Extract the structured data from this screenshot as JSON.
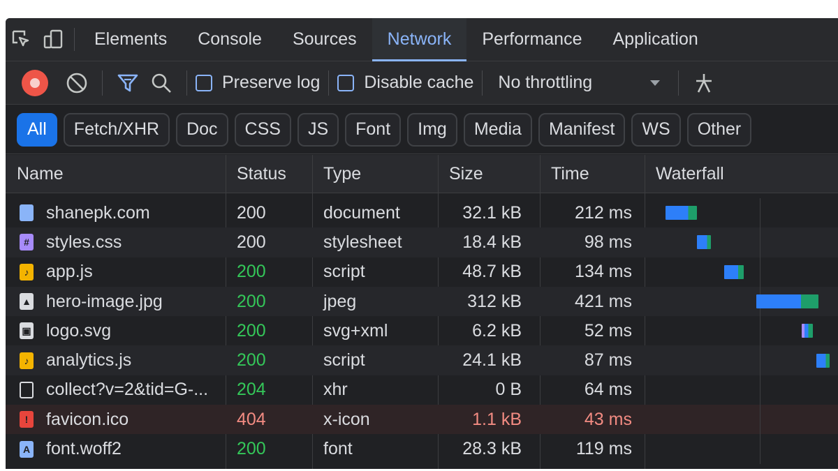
{
  "tabs": [
    {
      "label": "Elements",
      "active": false
    },
    {
      "label": "Console",
      "active": false
    },
    {
      "label": "Sources",
      "active": false
    },
    {
      "label": "Network",
      "active": true
    },
    {
      "label": "Performance",
      "active": false
    },
    {
      "label": "Application",
      "active": false
    }
  ],
  "toolbar": {
    "preserve_log": "Preserve log",
    "disable_cache": "Disable cache",
    "throttling": "No throttling"
  },
  "filters": [
    "All",
    "Fetch/XHR",
    "Doc",
    "CSS",
    "JS",
    "Font",
    "Img",
    "Media",
    "Manifest",
    "WS",
    "Other"
  ],
  "active_filter": "All",
  "columns": {
    "name": "Name",
    "status": "Status",
    "type": "Type",
    "size": "Size",
    "time": "Time",
    "waterfall": "Waterfall"
  },
  "colors": {
    "accent": "#8ab4f8",
    "record": "#ee5548",
    "ok_status": "#34c759",
    "error": "#f28b82",
    "bar_blue": "#2d7ff9",
    "bar_green": "#1e9e6a"
  },
  "requests": [
    {
      "name": "shanepk.com",
      "status": "200",
      "type": "document",
      "size": "32.1 kB",
      "time": "212 ms",
      "icon": "document-icon"
    },
    {
      "name": "styles.css",
      "status": "200",
      "type": "stylesheet",
      "size": "18.4 kB",
      "time": "98 ms",
      "icon": "stylesheet-icon"
    },
    {
      "name": "app.js",
      "status": "200",
      "type": "script",
      "size": "48.7 kB",
      "time": "134 ms",
      "icon": "script-icon"
    },
    {
      "name": "hero-image.jpg",
      "status": "200",
      "type": "jpeg",
      "size": "312 kB",
      "time": "421 ms",
      "icon": "image-icon"
    },
    {
      "name": "logo.svg",
      "status": "200",
      "type": "svg+xml",
      "size": "6.2 kB",
      "time": "52 ms",
      "icon": "svg-icon"
    },
    {
      "name": "analytics.js",
      "status": "200",
      "type": "script",
      "size": "24.1 kB",
      "time": "87 ms",
      "icon": "script-icon"
    },
    {
      "name": "collect?v=2&tid=G-...",
      "status": "204",
      "type": "xhr",
      "size": "0 B",
      "time": "64 ms",
      "icon": "xhr-icon"
    },
    {
      "name": "favicon.ico",
      "status": "404",
      "type": "x-icon",
      "size": "1.1 kB",
      "time": "43 ms",
      "icon": "error-file-icon"
    },
    {
      "name": "font.woff2",
      "status": "200",
      "type": "font",
      "size": "28.3 kB",
      "time": "119 ms",
      "icon": "font-file-icon"
    }
  ]
}
